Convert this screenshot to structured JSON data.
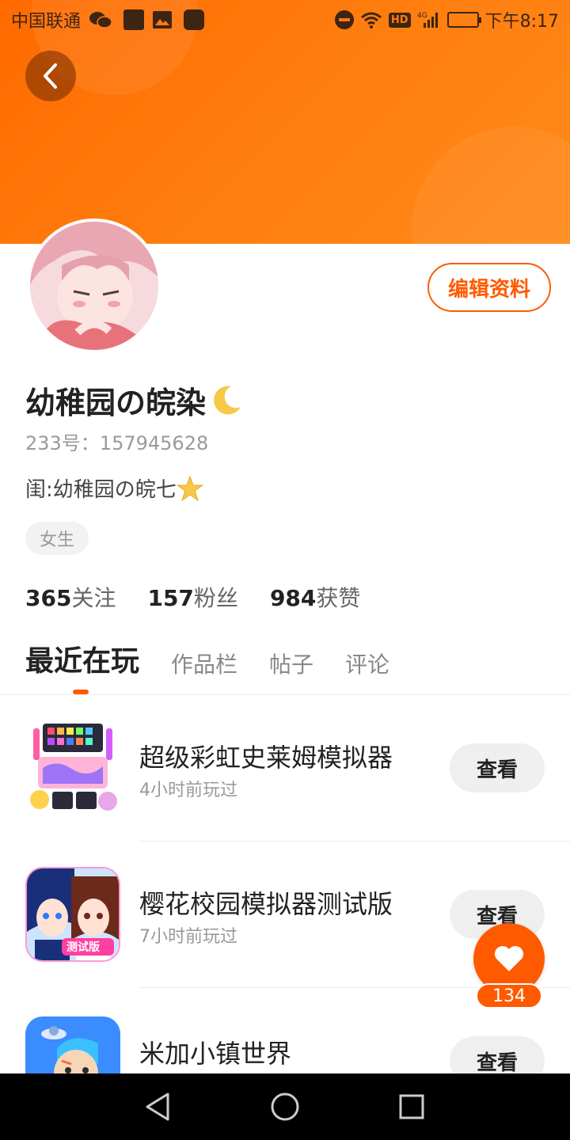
{
  "status_bar": {
    "carrier": "中国联通",
    "network": "4G",
    "hd": "HD",
    "time": "下午8:17"
  },
  "header": {
    "back_icon": "chevron-left-icon",
    "banner_color": "#ff7a10"
  },
  "profile": {
    "edit_button": "编辑资料",
    "nickname": "幼稚园の皖染",
    "nickname_emoji": "crescent-moon",
    "user_id": "233号：157945628",
    "bio": "闺:幼稚园の皖七",
    "bio_emoji": "star",
    "gender_tag": "女生",
    "stats": [
      {
        "num": "365",
        "label": "关注"
      },
      {
        "num": "157",
        "label": "粉丝"
      },
      {
        "num": "984",
        "label": "获赞"
      }
    ]
  },
  "tabs": [
    {
      "label": "最近在玩",
      "active": true
    },
    {
      "label": "作品栏",
      "active": false
    },
    {
      "label": "帖子",
      "active": false
    },
    {
      "label": "评论",
      "active": false
    }
  ],
  "games": [
    {
      "title": "超级彩虹史莱姆模拟器",
      "subtitle": "4小时前玩过",
      "button": "查看"
    },
    {
      "title": "樱花校园模拟器测试版",
      "subtitle": "7小时前玩过",
      "button": "查看"
    },
    {
      "title": "米加小镇世界",
      "subtitle": "",
      "button": "查看"
    }
  ],
  "like": {
    "count": "134",
    "icon": "heart-icon"
  },
  "accent_color": "#ff5a00"
}
